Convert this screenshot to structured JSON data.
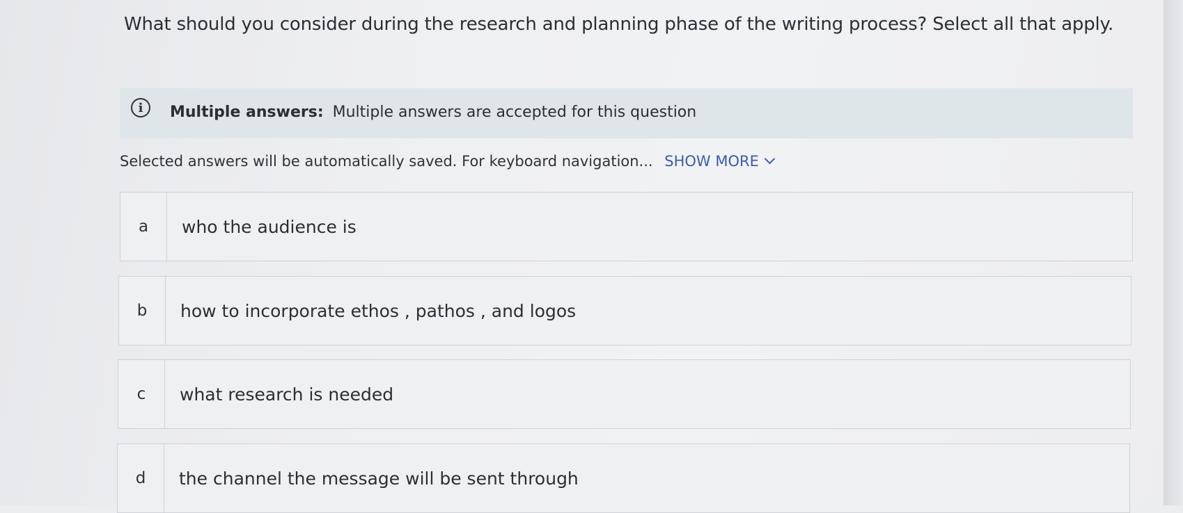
{
  "question": {
    "text": "What should you consider during the research and planning phase of the writing process? Select all that apply."
  },
  "info_banner": {
    "icon": "info-icon",
    "icon_glyph": "i",
    "label": "Multiple answers:",
    "message": "Multiple answers are accepted for this question"
  },
  "helper": {
    "text": "Selected answers will be automatically saved. For keyboard navigation...",
    "show_more_label": "SHOW MORE"
  },
  "options": [
    {
      "letter": "a",
      "text": "who the audience is"
    },
    {
      "letter": "b",
      "text": "how to incorporate ethos , pathos , and logos"
    },
    {
      "letter": "c",
      "text": "what research is needed"
    },
    {
      "letter": "d",
      "text": "the channel the message will be sent through"
    }
  ],
  "colors": {
    "link": "#3b5bb0",
    "banner_bg": "#dfe6ea",
    "page_bg": "#eeeff1"
  }
}
